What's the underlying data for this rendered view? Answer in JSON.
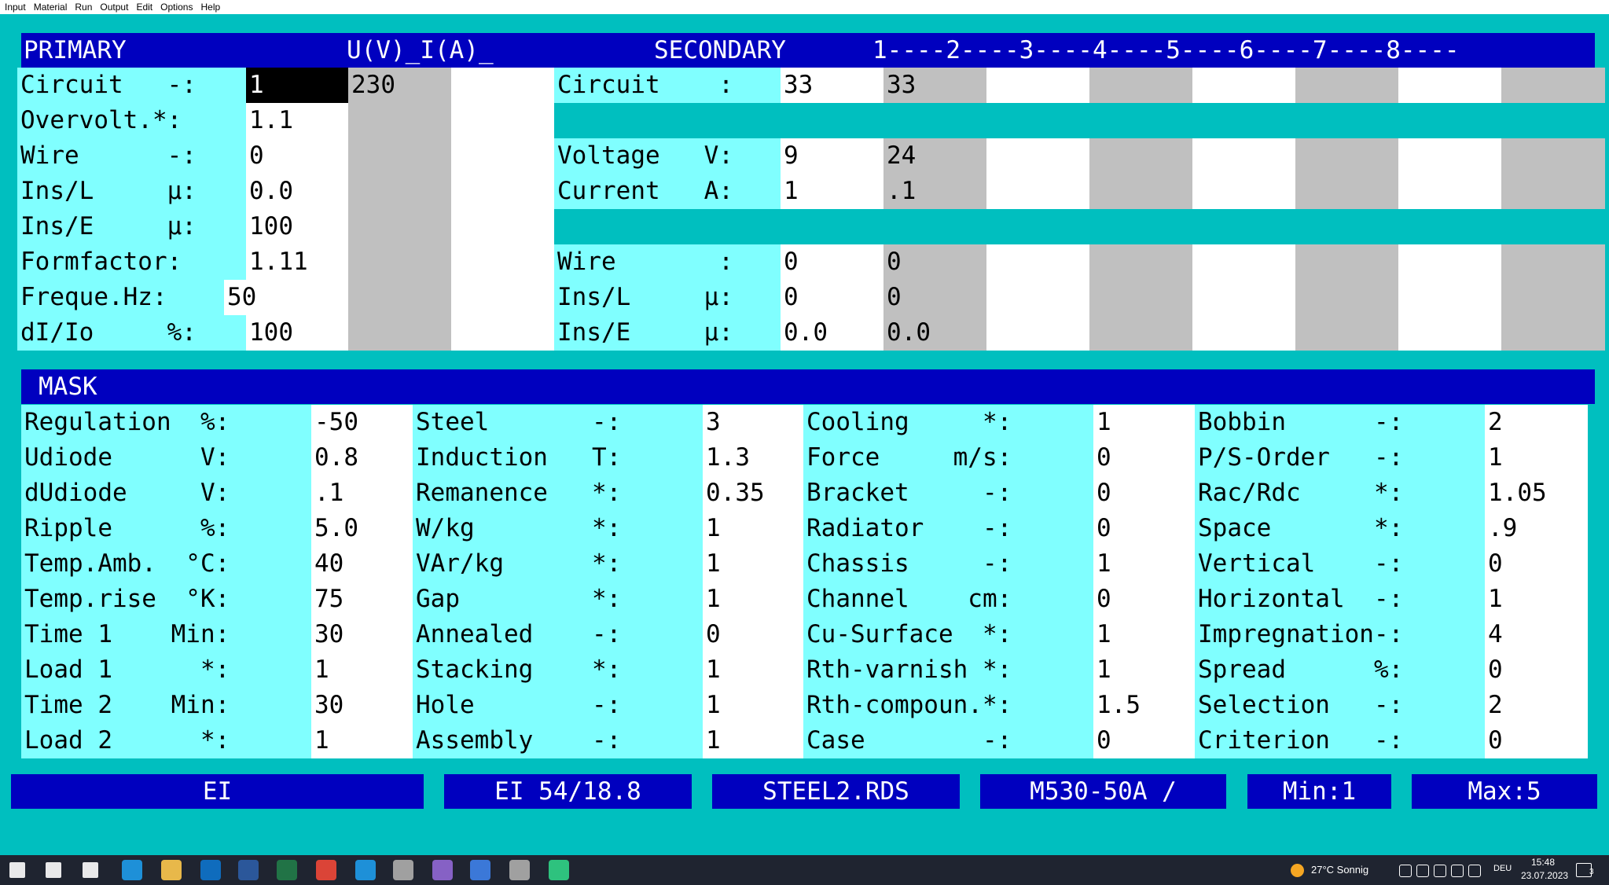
{
  "menu": [
    "Input",
    "Material",
    "Run",
    "Output",
    "Edit",
    "Options",
    "Help"
  ],
  "primary": {
    "header": "PRIMARY",
    "col_header": "U(V)_I(A)_",
    "rows": [
      {
        "label": "Circuit   -:",
        "value": "1",
        "value2": "230"
      },
      {
        "label": "Overvolt.*:",
        "value": "1.1",
        "value2": ""
      },
      {
        "label": "Wire      -:",
        "value": "0",
        "value2": ""
      },
      {
        "label": "Ins/L     µ:",
        "value": "0.0",
        "value2": ""
      },
      {
        "label": "Ins/E     µ:",
        "value": "100",
        "value2": ""
      },
      {
        "label": "Formfactor:",
        "value": "1.11",
        "value2": ""
      },
      {
        "label": "Freque.Hz:",
        "value": "50",
        "value2": ""
      },
      {
        "label": "dI/Io     %:",
        "value": "100",
        "value2": ""
      }
    ]
  },
  "secondary": {
    "header": "SECONDARY",
    "col_header": "1----2----3----4----5----6----7----8----",
    "rows": [
      {
        "label": "Circuit    :",
        "values": [
          "33",
          "33",
          "",
          "",
          "",
          "",
          "",
          ""
        ]
      },
      {
        "label": "",
        "values": []
      },
      {
        "label": "Voltage   V:",
        "values": [
          "9",
          "24",
          "",
          "",
          "",
          "",
          "",
          ""
        ]
      },
      {
        "label": "Current   A:",
        "values": [
          "1",
          ".1",
          "",
          "",
          "",
          "",
          "",
          ""
        ]
      },
      {
        "label": "",
        "values": []
      },
      {
        "label": "Wire       :",
        "values": [
          "0",
          "0",
          "",
          "",
          "",
          "",
          "",
          ""
        ]
      },
      {
        "label": "Ins/L     µ:",
        "values": [
          "0",
          "0",
          "",
          "",
          "",
          "",
          "",
          ""
        ]
      },
      {
        "label": "Ins/E     µ:",
        "values": [
          "0.0",
          "0.0",
          "",
          "",
          "",
          "",
          "",
          ""
        ]
      }
    ]
  },
  "mask": {
    "header": "MASK",
    "columns": [
      [
        {
          "label": "Regulation  %:",
          "value": "-50"
        },
        {
          "label": "Udiode      V:",
          "value": "0.8"
        },
        {
          "label": "dUdiode     V:",
          "value": ".1"
        },
        {
          "label": "Ripple      %:",
          "value": "5.0"
        },
        {
          "label": "Temp.Amb.  °C:",
          "value": "40"
        },
        {
          "label": "Temp.rise  °K:",
          "value": "75"
        },
        {
          "label": "Time 1    Min:",
          "value": "30"
        },
        {
          "label": "Load 1      *:",
          "value": "1"
        },
        {
          "label": "Time 2    Min:",
          "value": "30"
        },
        {
          "label": "Load 2      *:",
          "value": "1"
        }
      ],
      [
        {
          "label": "Steel       -:",
          "value": "3"
        },
        {
          "label": "Induction   T:",
          "value": "1.3"
        },
        {
          "label": "Remanence   *:",
          "value": "0.35"
        },
        {
          "label": "W/kg        *:",
          "value": "1"
        },
        {
          "label": "VAr/kg      *:",
          "value": "1"
        },
        {
          "label": "Gap         *:",
          "value": "1"
        },
        {
          "label": "Annealed    -:",
          "value": "0"
        },
        {
          "label": "Stacking    *:",
          "value": "1"
        },
        {
          "label": "Hole        -:",
          "value": "1"
        },
        {
          "label": "Assembly    -:",
          "value": "1"
        }
      ],
      [
        {
          "label": "Cooling     *:",
          "value": "1"
        },
        {
          "label": "Force     m/s:",
          "value": "0"
        },
        {
          "label": "Bracket     -:",
          "value": "0"
        },
        {
          "label": "Radiator    -:",
          "value": "0"
        },
        {
          "label": "Chassis     -:",
          "value": "1"
        },
        {
          "label": "Channel    cm:",
          "value": "0"
        },
        {
          "label": "Cu-Surface  *:",
          "value": "1"
        },
        {
          "label": "Rth-varnish *:",
          "value": "1"
        },
        {
          "label": "Rth-compoun.*:",
          "value": "1.5"
        },
        {
          "label": "Case        -:",
          "value": "0"
        }
      ],
      [
        {
          "label": "Bobbin      -:",
          "value": "2"
        },
        {
          "label": "P/S-Order   -:",
          "value": "1"
        },
        {
          "label": "Rac/Rdc     *:",
          "value": "1.05"
        },
        {
          "label": "Space       *:",
          "value": ".9"
        },
        {
          "label": "Vertical    -:",
          "value": "0"
        },
        {
          "label": "Horizontal  -:",
          "value": "1"
        },
        {
          "label": "Impregnation-:",
          "value": "4"
        },
        {
          "label": "Spread      %:",
          "value": "0"
        },
        {
          "label": "Selection   -:",
          "value": "2"
        },
        {
          "label": "Criterion   -:",
          "value": "0"
        }
      ]
    ]
  },
  "status": [
    "EI",
    "EI 54/18.8",
    "STEEL2.RDS",
    "M530-50A /",
    "Min:1",
    "Max:5"
  ],
  "taskbar": {
    "icons": [
      "windows-start",
      "search",
      "task-view",
      "edge",
      "file-explorer",
      "outlook",
      "word",
      "excel",
      "chrome",
      "internet-explorer",
      "z-app",
      "visual-studio",
      "a-app",
      "z-app-2",
      "calculator"
    ],
    "weather": "27°C Sonnig",
    "lang": "DEU",
    "time": "15:48",
    "date": "23.07.2023",
    "notif": "3",
    "colors": {
      "bg": "#1f2430",
      "accent": "#0078d4"
    }
  }
}
